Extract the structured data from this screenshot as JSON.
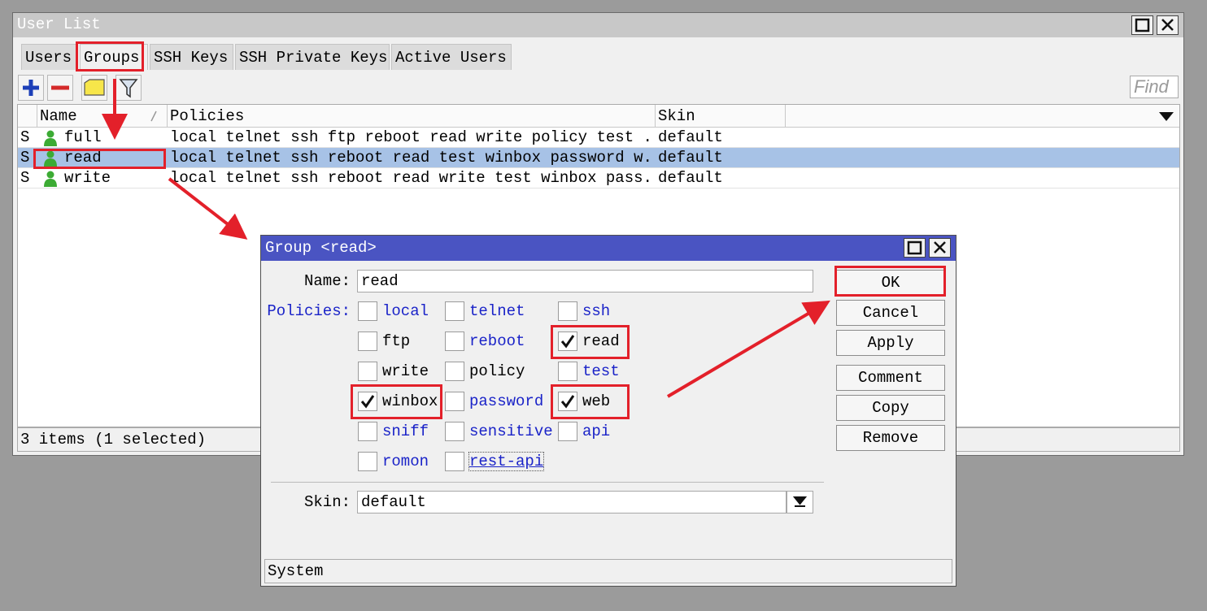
{
  "main_window": {
    "title": "User List",
    "tabs": [
      "Users",
      "Groups",
      "SSH Keys",
      "SSH Private Keys",
      "Active Users"
    ],
    "active_tab": "Groups",
    "find_placeholder": "Find",
    "columns": {
      "name": "Name",
      "policies": "Policies",
      "skin": "Skin"
    },
    "rows": [
      {
        "flag": "S",
        "name": "full",
        "policies": "local telnet ssh ftp reboot read write policy test ...",
        "skin": "default",
        "selected": false
      },
      {
        "flag": "S",
        "name": "read",
        "policies": "local telnet ssh reboot read test winbox password w...",
        "skin": "default",
        "selected": true
      },
      {
        "flag": "S",
        "name": "write",
        "policies": "local telnet ssh reboot read write test winbox pass...",
        "skin": "default",
        "selected": false
      }
    ],
    "status": "3 items (1 selected)"
  },
  "dialog": {
    "title": "Group <read>",
    "name_label": "Name:",
    "name_value": "read",
    "policies_label": "Policies:",
    "policies": [
      {
        "label": "local",
        "checked": false,
        "style": "link"
      },
      {
        "label": "telnet",
        "checked": false,
        "style": "link"
      },
      {
        "label": "ssh",
        "checked": false,
        "style": "link"
      },
      {
        "label": "ftp",
        "checked": false,
        "style": "plain"
      },
      {
        "label": "reboot",
        "checked": false,
        "style": "link"
      },
      {
        "label": "read",
        "checked": true,
        "style": "plain"
      },
      {
        "label": "write",
        "checked": false,
        "style": "plain"
      },
      {
        "label": "policy",
        "checked": false,
        "style": "plain"
      },
      {
        "label": "test",
        "checked": false,
        "style": "link"
      },
      {
        "label": "winbox",
        "checked": true,
        "style": "plain"
      },
      {
        "label": "password",
        "checked": false,
        "style": "link"
      },
      {
        "label": "web",
        "checked": true,
        "style": "plain"
      },
      {
        "label": "sniff",
        "checked": false,
        "style": "link"
      },
      {
        "label": "sensitive",
        "checked": false,
        "style": "link"
      },
      {
        "label": "api",
        "checked": false,
        "style": "link"
      },
      {
        "label": "romon",
        "checked": false,
        "style": "link"
      },
      {
        "label": "rest-api",
        "checked": false,
        "style": "link"
      }
    ],
    "skin_label": "Skin:",
    "skin_value": "default",
    "buttons": {
      "ok": "OK",
      "cancel": "Cancel",
      "apply": "Apply",
      "comment": "Comment",
      "copy": "Copy",
      "remove": "Remove"
    },
    "status": "System"
  },
  "colors": {
    "highlight": "#e3202a",
    "dialog_title": "#4a54c2",
    "selected_row": "#a7c2e6",
    "link": "#1a23c8"
  }
}
